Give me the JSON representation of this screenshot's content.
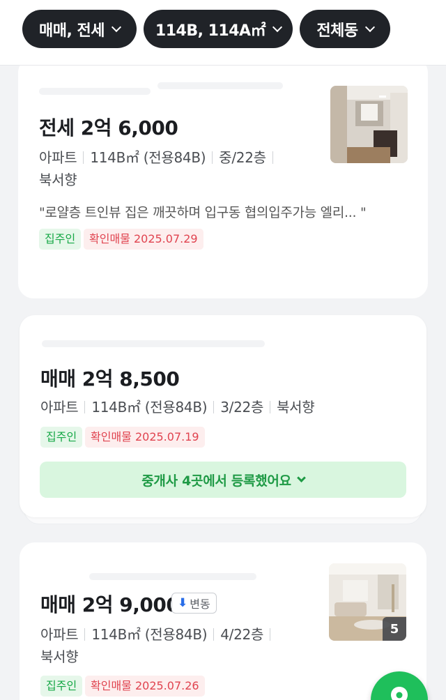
{
  "filters": {
    "trade_type": "매매, 전세",
    "area": "114B, 114A㎡",
    "dong": "전체동"
  },
  "listings": [
    {
      "price": "전세 2억 6,000",
      "type": "아파트",
      "area": "114B㎡ (전용84B)",
      "floor": "중/22층",
      "direction": "북서향",
      "description": "\"로얄층 트인뷰 집은 깨끗하며 입구동 협의입주가능 엘리...   \"",
      "badge_owner": "집주인",
      "badge_verified": "확인매물 2025.07.29"
    },
    {
      "price": "매매 2억 8,500",
      "type": "아파트",
      "area": "114B㎡ (전용84B)",
      "floor": "3/22층",
      "direction": "북서향",
      "badge_owner": "집주인",
      "badge_verified": "확인매물 2025.07.19",
      "agents_label": "중개사 4곳에서 등록했어요"
    },
    {
      "price": "매매 2억 9,000",
      "change_label": "변동",
      "type": "아파트",
      "area": "114B㎡ (전용84B)",
      "floor": "4/22층",
      "direction": "북서향",
      "badge_owner": "집주인",
      "badge_verified": "확인매물 2025.07.26",
      "photo_count": "5"
    }
  ],
  "colors": {
    "chip_bg": "#202328",
    "accent_green": "#1fbf5b",
    "verified_red": "#e0434f",
    "change_blue": "#2a6ee8"
  }
}
